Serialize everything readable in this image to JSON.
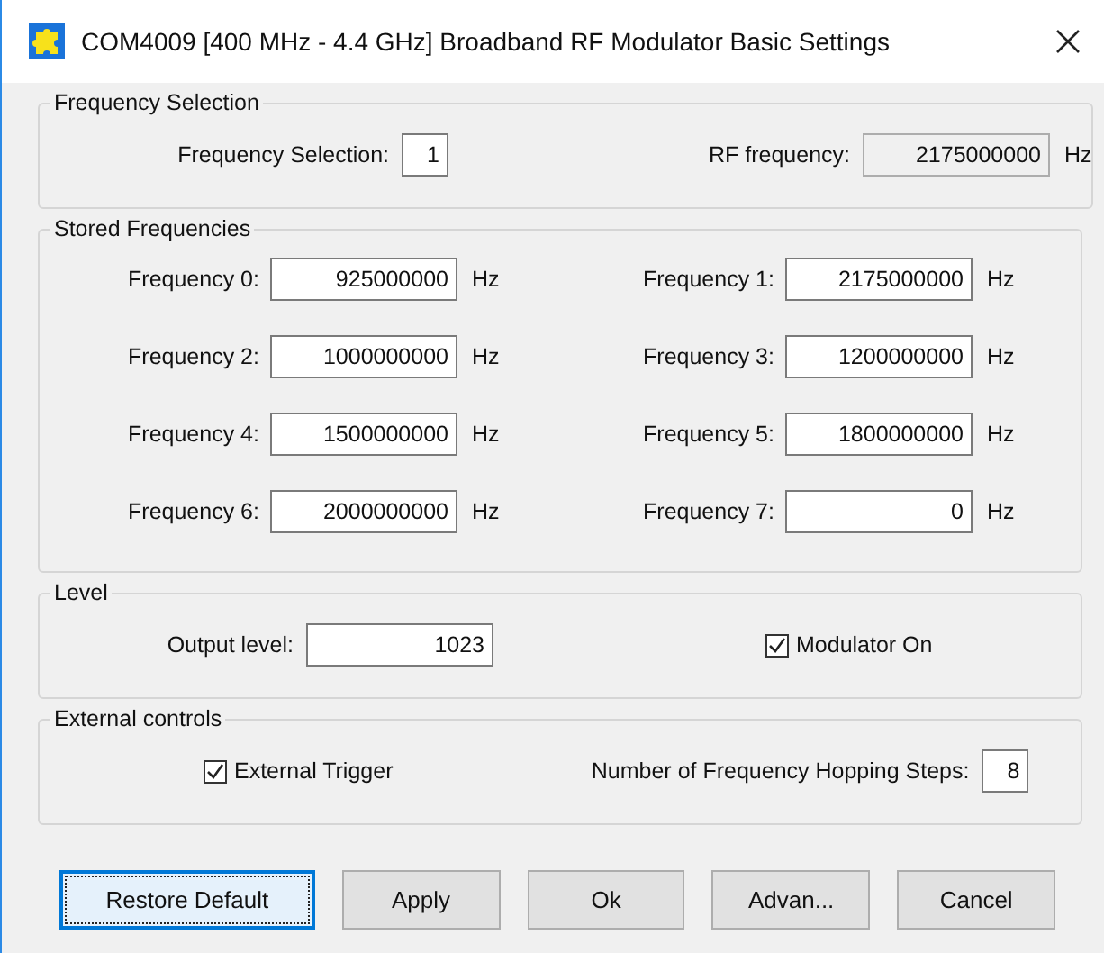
{
  "window": {
    "title": "COM4009 [400 MHz - 4.4 GHz] Broadband RF Modulator Basic Settings"
  },
  "frequency_selection": {
    "legend": "Frequency Selection",
    "selection_label": "Frequency Selection:",
    "selection_value": "1",
    "rf_label": "RF frequency:",
    "rf_value": "2175000000",
    "rf_unit": "Hz",
    "rf_readonly": true
  },
  "stored_frequencies": {
    "legend": "Stored Frequencies",
    "items": [
      {
        "label": "Frequency 0:",
        "value": "925000000",
        "unit": "Hz"
      },
      {
        "label": "Frequency 1:",
        "value": "2175000000",
        "unit": "Hz"
      },
      {
        "label": "Frequency 2:",
        "value": "1000000000",
        "unit": "Hz"
      },
      {
        "label": "Frequency 3:",
        "value": "1200000000",
        "unit": "Hz"
      },
      {
        "label": "Frequency 4:",
        "value": "1500000000",
        "unit": "Hz"
      },
      {
        "label": "Frequency 5:",
        "value": "1800000000",
        "unit": "Hz"
      },
      {
        "label": "Frequency 6:",
        "value": "2000000000",
        "unit": "Hz"
      },
      {
        "label": "Frequency 7:",
        "value": "0",
        "unit": "Hz"
      }
    ]
  },
  "level": {
    "legend": "Level",
    "output_label": "Output level:",
    "output_value": "1023",
    "modulator": {
      "label": "Modulator On",
      "checked": true
    }
  },
  "external_controls": {
    "legend": "External controls",
    "trigger": {
      "label": "External Trigger",
      "checked": true
    },
    "steps_label": "Number of Frequency Hopping Steps:",
    "steps_value": "8"
  },
  "buttons": [
    {
      "label": "Restore Default",
      "focused": true
    },
    {
      "label": "Apply",
      "focused": false
    },
    {
      "label": "Ok",
      "focused": false
    },
    {
      "label": "Advan...",
      "focused": false
    },
    {
      "label": "Cancel",
      "focused": false
    }
  ]
}
